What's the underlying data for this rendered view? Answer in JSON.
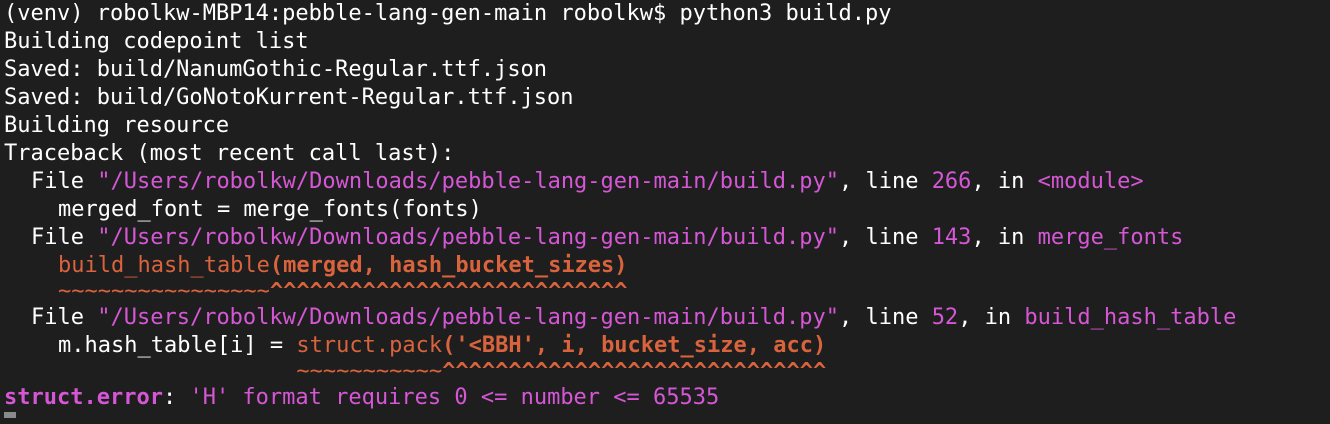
{
  "prompt": {
    "venv": "(venv)",
    "host": "robolkw-MBP14:pebble-lang-gen-main",
    "user": "robolkw$",
    "command": "python3 build.py"
  },
  "output": {
    "line1": "Building codepoint list",
    "line2": "Saved: build/NanumGothic-Regular.ttf.json",
    "line3": "Saved: build/GoNotoKurrent-Regular.ttf.json",
    "line4": "Building resource",
    "traceback_header": "Traceback (most recent call last):"
  },
  "frames": [
    {
      "file_kw": "File ",
      "path": "\"/Users/robolkw/Downloads/pebble-lang-gen-main/build.py\"",
      "line_kw": ", line ",
      "line_no": "266",
      "in_kw": ", in ",
      "func": "<module>",
      "code": "merged_font = merge_fonts(fonts)"
    },
    {
      "file_kw": "File ",
      "path": "\"/Users/robolkw/Downloads/pebble-lang-gen-main/build.py\"",
      "line_kw": ", line ",
      "line_no": "143",
      "in_kw": ", in ",
      "func": "merge_fonts",
      "code_call": "build_hash_table",
      "code_args": "(merged, hash_bucket_sizes)",
      "marker_tilde": "~~~~~~~~~~~~~~~~",
      "marker_caret": "^^^^^^^^^^^^^^^^^^^^^^^^^^^"
    },
    {
      "file_kw": "File ",
      "path": "\"/Users/robolkw/Downloads/pebble-lang-gen-main/build.py\"",
      "line_kw": ", line ",
      "line_no": "52",
      "in_kw": ", in ",
      "func": "build_hash_table",
      "code_prefix": "m.hash_table[i] = ",
      "code_call": "struct.pack",
      "code_args": "('<BBH', i, bucket_size, acc)",
      "marker_pad": "                  ",
      "marker_tilde": "~~~~~~~~~~~",
      "marker_caret": "^^^^^^^^^^^^^^^^^^^^^^^^^^^^^"
    }
  ],
  "error": {
    "name": "struct.error",
    "sep": ": ",
    "message": "'H' format requires 0 <= number <= 65535"
  },
  "colors": {
    "background": "#1e1e1e",
    "text": "#ffffff",
    "magenta": "#d557d5",
    "orange": "#d9633c"
  }
}
